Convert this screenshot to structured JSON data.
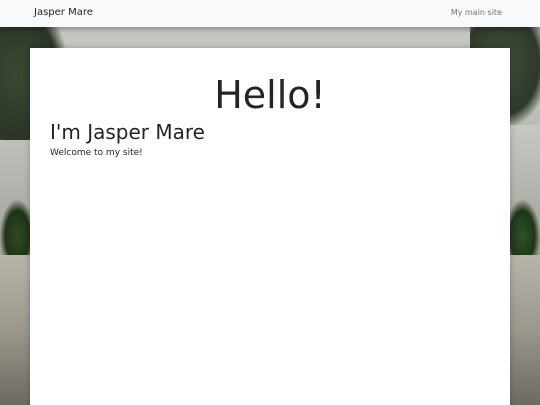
{
  "navbar": {
    "brand": "Jasper Mare",
    "link": "My main site"
  },
  "main": {
    "greeting": "Hello!",
    "heading": "I'm Jasper Mare",
    "subtext": "Welcome to my site!"
  },
  "colors": {
    "navbar_bg": "#f8f9fa",
    "text": "#212529",
    "muted_link": "#6c757d",
    "card_bg": "#ffffff"
  }
}
